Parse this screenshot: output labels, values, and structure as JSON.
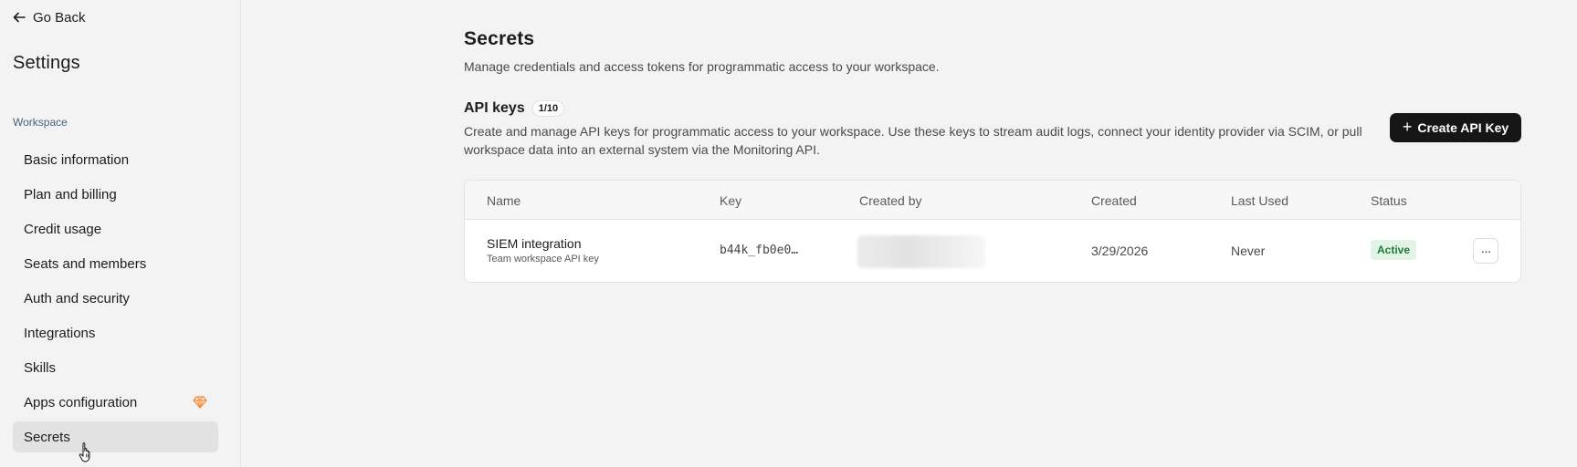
{
  "sidebar": {
    "back_label": "Go Back",
    "title": "Settings",
    "section": "Workspace",
    "items": [
      {
        "label": "Basic information"
      },
      {
        "label": "Plan and billing"
      },
      {
        "label": "Credit usage"
      },
      {
        "label": "Seats and members"
      },
      {
        "label": "Auth and security"
      },
      {
        "label": "Integrations"
      },
      {
        "label": "Skills"
      },
      {
        "label": "Apps configuration",
        "badge_icon": "gem-icon",
        "badge_color": "#f08a3a"
      },
      {
        "label": "Secrets",
        "active": true
      }
    ]
  },
  "main": {
    "title": "Secrets",
    "description": "Manage credentials and access tokens for programmatic access to your workspace.",
    "api_keys": {
      "heading": "API keys",
      "count": "1/10",
      "description": "Create and manage API keys for programmatic access to your workspace. Use these keys to stream audit logs, connect your identity provider via SCIM, or pull workspace data into an external system via the Monitoring API.",
      "create_button": "Create API Key",
      "columns": [
        "Name",
        "Key",
        "Created by",
        "Created",
        "Last Used",
        "Status"
      ],
      "rows": [
        {
          "name": "SIEM integration",
          "subtitle": "Team workspace API key",
          "key": "b44k_fb0e0…",
          "created": "3/29/2026",
          "last_used": "Never",
          "status": "Active",
          "more_label": "···"
        }
      ]
    }
  },
  "colors": {
    "primary_button": "#161616",
    "status_active_bg": "#e1f4e6",
    "status_active_text": "#1f7a3a"
  }
}
